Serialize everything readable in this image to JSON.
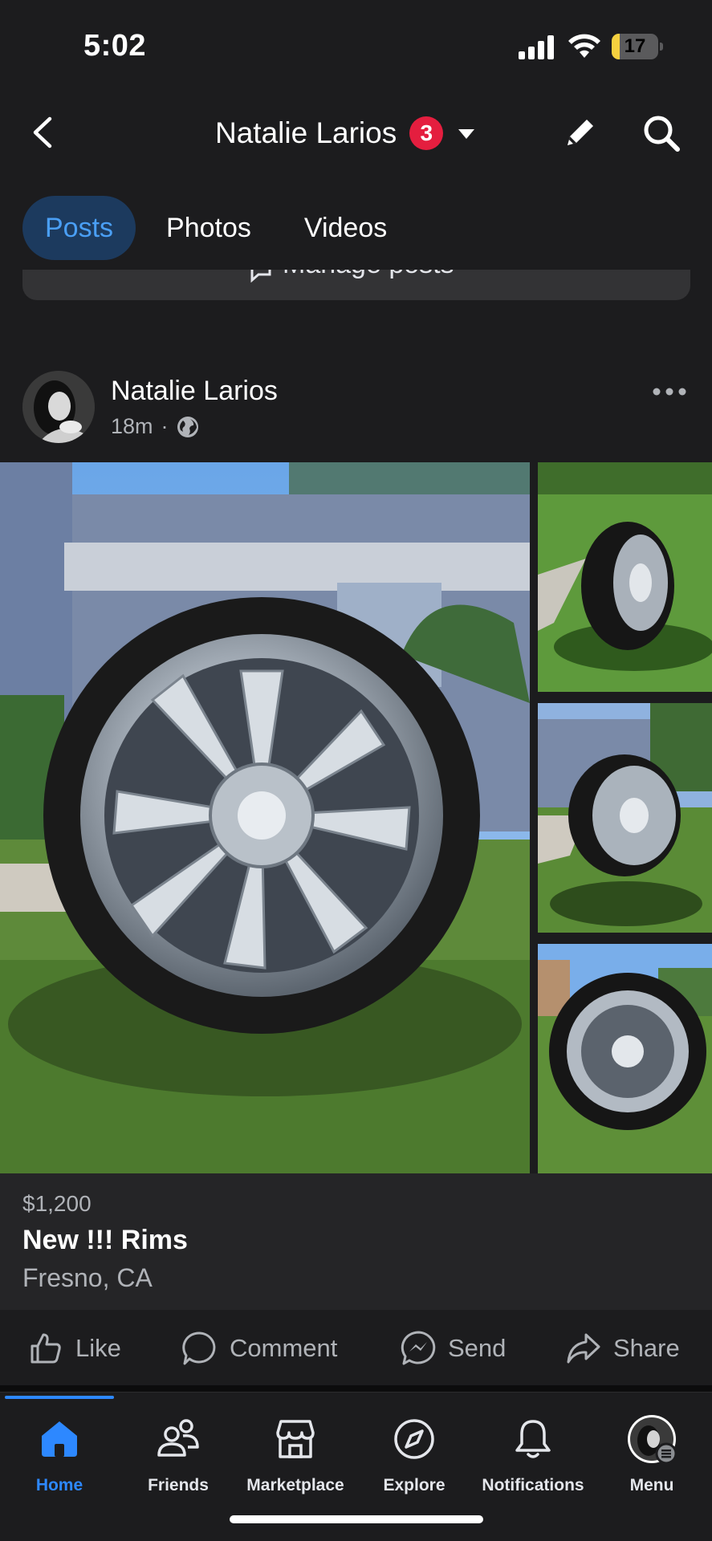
{
  "status_bar": {
    "time": "5:02",
    "battery": "17",
    "battery_level": 0.17
  },
  "header": {
    "title": "Natalie Larios",
    "badge_count": "3"
  },
  "tabs": [
    {
      "label": "Posts",
      "active": true
    },
    {
      "label": "Photos",
      "active": false
    },
    {
      "label": "Videos",
      "active": false
    }
  ],
  "manage_posts": {
    "label": "Manage posts"
  },
  "post": {
    "author": "Natalie Larios",
    "time": "18m",
    "separator": "·",
    "privacy_icon": "globe-icon",
    "listing": {
      "price": "$1,200",
      "title": "New !!! Rims",
      "location": "Fresno, CA"
    },
    "actions": {
      "like": "Like",
      "comment": "Comment",
      "send": "Send",
      "share": "Share"
    }
  },
  "bottom_nav": [
    {
      "label": "Home",
      "icon": "home-icon",
      "active": true
    },
    {
      "label": "Friends",
      "icon": "friends-icon",
      "active": false
    },
    {
      "label": "Marketplace",
      "icon": "marketplace-icon",
      "active": false
    },
    {
      "label": "Explore",
      "icon": "compass-icon",
      "active": false
    },
    {
      "label": "Notifications",
      "icon": "bell-icon",
      "active": false
    },
    {
      "label": "Menu",
      "icon": "profile-avatar-icon",
      "active": false
    }
  ],
  "colors": {
    "accent": "#2d88ff",
    "badge": "#e41e3f",
    "background": "#1c1c1e"
  }
}
